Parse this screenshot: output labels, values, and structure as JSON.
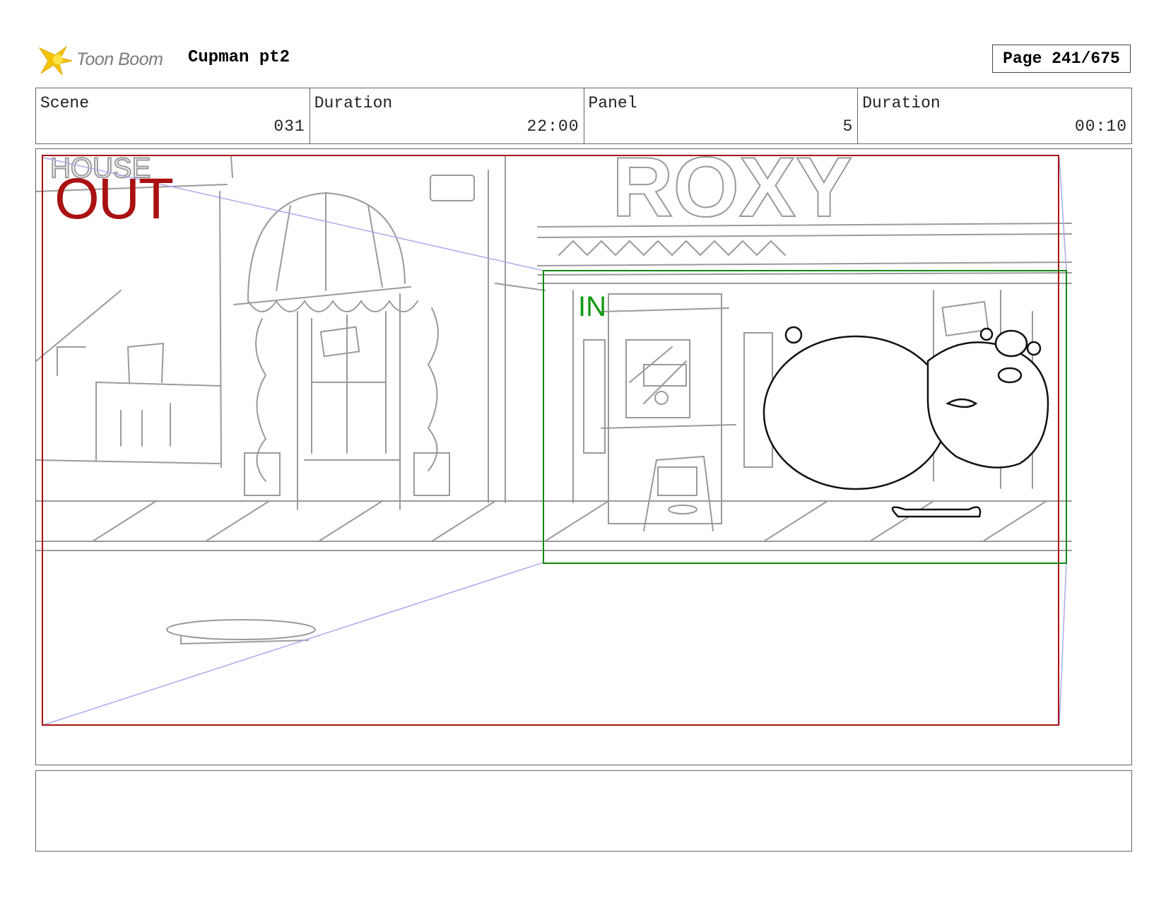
{
  "header": {
    "logo_text": "Toon Boom",
    "project_title": "Cupman pt2",
    "page_label": "Page 241/675"
  },
  "info": {
    "scene_label": "Scene",
    "scene_value": "031",
    "scene_duration_label": "Duration",
    "scene_duration_value": "22:00",
    "panel_label": "Panel",
    "panel_value": "5",
    "panel_duration_label": "Duration",
    "panel_duration_value": "00:10"
  },
  "panel": {
    "out_label": "OUT",
    "in_label": "IN",
    "sign_marquee": "ROXY",
    "sign_house": "HOUSE",
    "out_color": "#aa1111",
    "in_color": "#119911"
  },
  "notes": {
    "text": ""
  }
}
